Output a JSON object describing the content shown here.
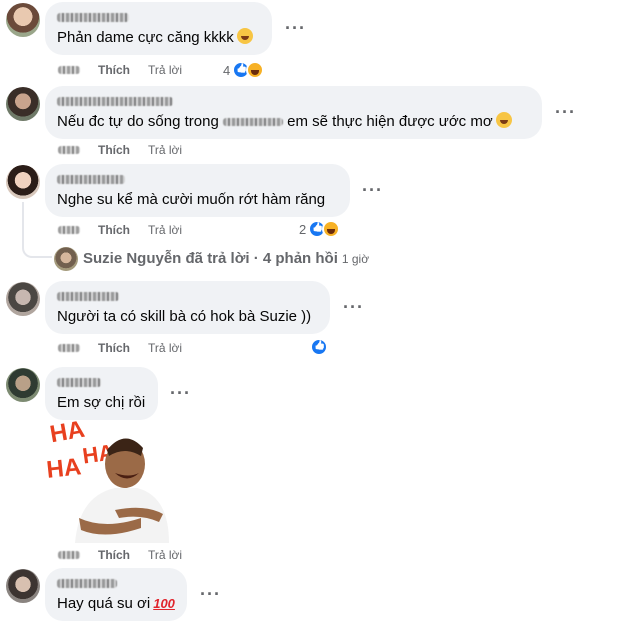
{
  "labels": {
    "like": "Thích",
    "reply": "Trả lời"
  },
  "comments": [
    {
      "text": "Phản dame cực căng kkkk",
      "reaction_count": "4"
    },
    {
      "text": "Nếu đc tự do sống trong",
      "text_after": "em sẽ thực hiện được ước mơ"
    },
    {
      "text": "Nghe su kể mà cười muốn rớt hàm răng",
      "reaction_count": "2",
      "replies_summary": "Suzie Nguyễn đã trả lời · 4 phản hồi",
      "replies_time": "1 giờ"
    },
    {
      "text": "Người ta có skill bà có hok bà Suzie ))"
    },
    {
      "text": "Em sợ chị rồi",
      "sticker_text": "HA HA HA"
    },
    {
      "text": "Hay quá su ơi"
    }
  ],
  "icons": {
    "like": "like-reaction-icon",
    "haha": "haha-reaction-icon",
    "more": "more-options-icon",
    "emoji_laugh": "rofl-emoji-icon",
    "emoji_100": "hundred-points-emoji-icon"
  },
  "colors": {
    "like_blue": "#1877f2",
    "bubble_bg": "#f0f2f5",
    "meta_gray": "#65676b"
  }
}
